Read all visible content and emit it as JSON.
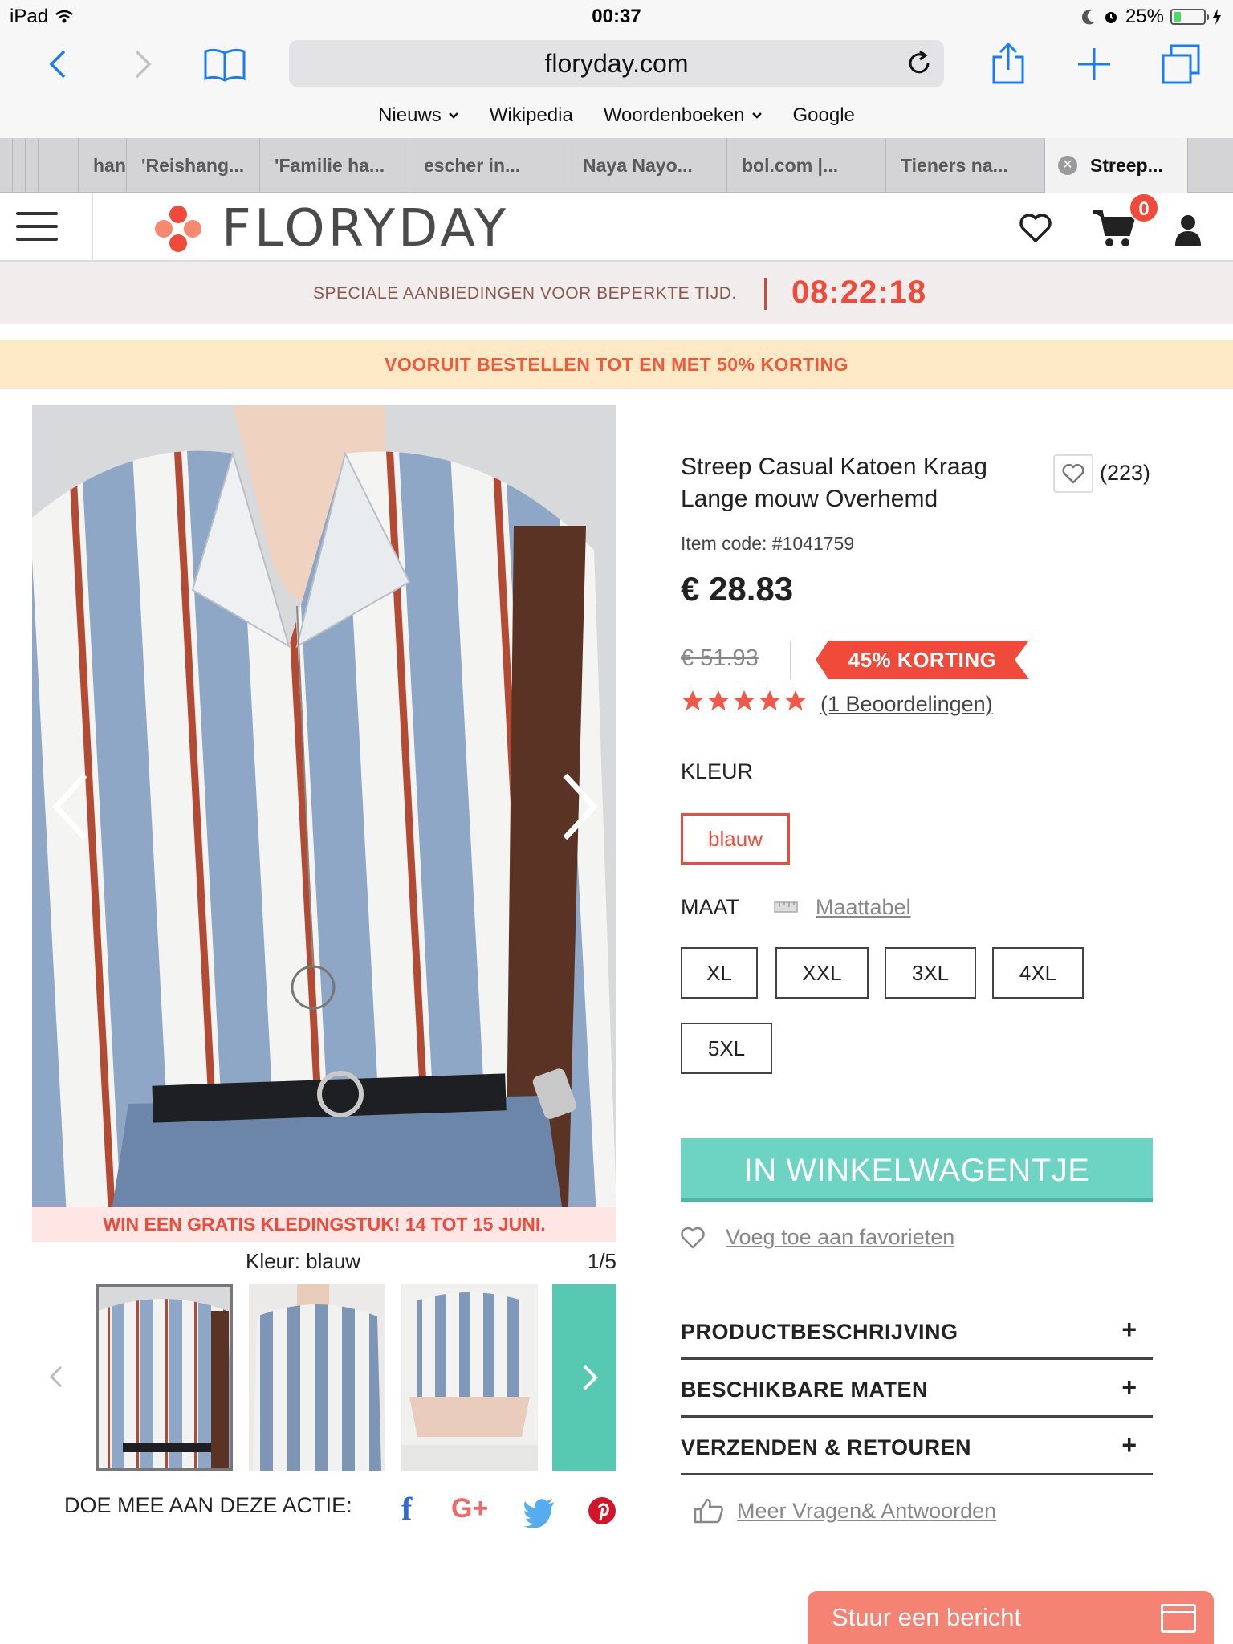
{
  "status_bar": {
    "device": "iPad",
    "time": "00:37",
    "battery": "25%",
    "battery_level": 0.25
  },
  "safari": {
    "url": "floryday.com",
    "favorites": [
      "Nieuws",
      "Wikipedia",
      "Woordenboeken",
      "Google"
    ]
  },
  "tabs": [
    "han",
    "'Reishang...",
    "'Familie ha...",
    "escher in...",
    "Naya Nayo...",
    "bol.com |...",
    "Tieners na...",
    "Streep..."
  ],
  "site": {
    "brand": "FLORYDAY",
    "cart_count": "0"
  },
  "promo": {
    "countdown_label": "SPECIALE AANBIEDINGEN VOOR BEPERKTE TIJD.",
    "countdown_time": "08:22:18",
    "preorder": "VOORUIT BESTELLEN TOT EN MET 50% KORTING"
  },
  "gallery": {
    "win_banner": "WIN EEN GRATIS KLEDINGSTUK! 14 TOT 15 JUNI.",
    "color_caption": "Kleur: blauw",
    "counter": "1/5",
    "share_label": "DOE MEE AAN DEZE ACTIE:"
  },
  "product": {
    "title": "Streep Casual Katoen Kraag Lange mouw Overhemd",
    "wish_count": "(223)",
    "item_code": "Item code: #1041759",
    "price": "€ 28.83",
    "old_price": "€ 51.93",
    "discount": "45% KORTING",
    "rating": 5,
    "reviews": "(1 Beoordelingen)",
    "color_label": "KLEUR",
    "color_value": "blauw",
    "size_label": "MAAT",
    "size_chart": "Maattabel",
    "sizes": [
      "XL",
      "XXL",
      "3XL",
      "4XL",
      "5XL"
    ],
    "add_to_cart": "IN WINKELWAGENTJE",
    "add_favorite": "Voeg toe aan favorieten",
    "sections": [
      "PRODUCTBESCHRIJVING",
      "BESCHIKBARE MATEN",
      "VERZENDEN & RETOUREN"
    ],
    "qa_link": "Meer Vragen& Antwoorden"
  },
  "chat": {
    "label": "Stuur een bericht"
  },
  "colors": {
    "accent": "#f04a3a",
    "teal": "#6dd3c3",
    "ios_blue": "#1a7cf5"
  }
}
